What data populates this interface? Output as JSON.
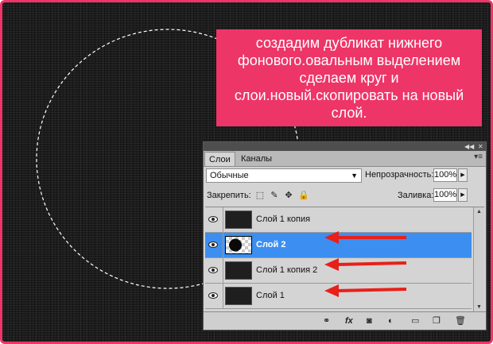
{
  "callout": {
    "text": "создадим дубликат нижнего фонового.овальным выделением сделаем круг и слои.новый.скопировать на новый слой."
  },
  "panel": {
    "tabs": [
      {
        "label": "Слои"
      },
      {
        "label": "Каналы"
      }
    ],
    "blend_mode": "Обычные",
    "opacity_label": "Непрозрачность:",
    "opacity_value": "100%",
    "lock_label": "Закрепить:",
    "fill_label": "Заливка:",
    "fill_value": "100%",
    "layers": [
      {
        "name": "Слой 1 копия",
        "selected": false,
        "visible": true
      },
      {
        "name": "Слой 2",
        "selected": true,
        "visible": true
      },
      {
        "name": "Слой 1 копия 2",
        "selected": false,
        "visible": true
      },
      {
        "name": "Слой 1",
        "selected": false,
        "visible": true
      }
    ],
    "bottom_icons": [
      "link-icon",
      "fx-icon",
      "mask-icon",
      "adjustment-icon",
      "folder-icon",
      "new-layer-icon",
      "trash-icon"
    ]
  },
  "colors": {
    "frame_border": "#ee3568",
    "callout_bg": "#ee3568",
    "selected_layer": "#3c8ff0",
    "arrow": "#e8201a"
  }
}
